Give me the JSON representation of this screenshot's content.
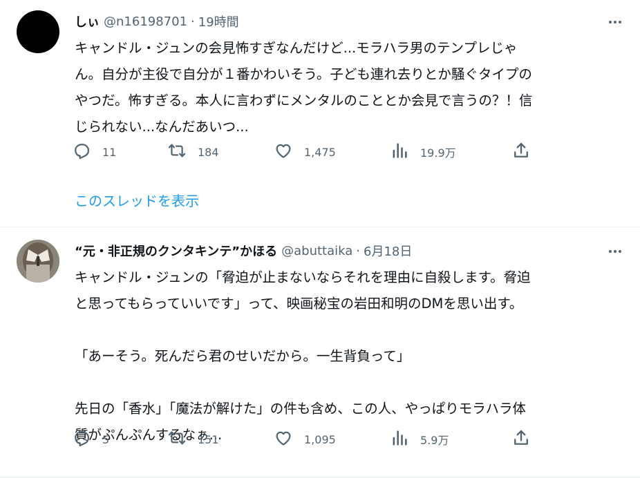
{
  "tweets": [
    {
      "display_name": "しぃ",
      "handle": "@n16198701",
      "separator": "·",
      "time": "19時間",
      "text_lines": [
        "キャンドル・ジュンの会見怖すぎなんだけど...モラハラ男のテンプレじゃ",
        "ん。自分が主役で自分が１番かわいそう。子ども連れ去りとか騒ぐタイプの",
        "やつだ。怖すぎる。本人に言わずにメンタルのこととか会見で言うの？！信",
        "じられない...なんだあいつ..."
      ],
      "reply_count": "11",
      "retweet_count": "184",
      "like_count": "1,475",
      "view_count": "19.9万",
      "thread_link": "このスレッドを表示",
      "avatar_color": "#000000"
    },
    {
      "display_name": "“元・非正規のクンタキンテ”かほる",
      "handle": "@abuttaika",
      "separator": "·",
      "time": "6月18日",
      "text_lines": [
        "キャンドル・ジュンの「脅迫が止まないならそれを理由に自殺します。脅迫",
        "と思ってもらっていいです」って、映画秘宝の岩田和明のDMを思い出す。",
        "",
        "「あーそう。死んだら君のせいだから。一生背負って」",
        "",
        "先日の「香水」「魔法が解けた」の件も含め、この人、やっぱりモラハラ体",
        "質がぷんぷんするなぁ..."
      ],
      "reply_count": "5",
      "retweet_count": "151",
      "like_count": "1,095",
      "view_count": "5.9万"
    }
  ],
  "colors": {
    "text": "#0f1419",
    "secondary": "#536471",
    "link": "#1d9bf0",
    "divider": "#eff3f4"
  },
  "icons": [
    "more-icon",
    "reply-icon",
    "retweet-icon",
    "like-icon",
    "views-icon",
    "share-icon"
  ]
}
